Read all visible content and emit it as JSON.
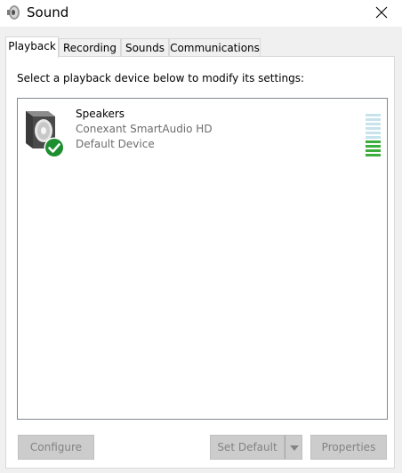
{
  "window": {
    "title": "Sound"
  },
  "tabs": [
    {
      "label": "Playback",
      "active": true
    },
    {
      "label": "Recording",
      "active": false
    },
    {
      "label": "Sounds",
      "active": false
    },
    {
      "label": "Communications",
      "active": false
    }
  ],
  "playback": {
    "instructions": "Select a playback device below to modify its settings:",
    "devices": [
      {
        "name": "Speakers",
        "driver": "Conexant SmartAudio HD",
        "status": "Default Device",
        "is_default": true,
        "icon": "speaker-icon",
        "level_meter": {
          "segments_total": 10,
          "segments_lit": 4,
          "lit_color": "#3cae3c",
          "unlit_color": "#c7e3ec"
        }
      }
    ]
  },
  "buttons": {
    "configure": "Configure",
    "set_default": "Set Default",
    "properties": "Properties"
  },
  "colors": {
    "default_check": "#1e8f31",
    "disabled_button_bg": "#cccccc",
    "disabled_button_text": "#838383"
  }
}
